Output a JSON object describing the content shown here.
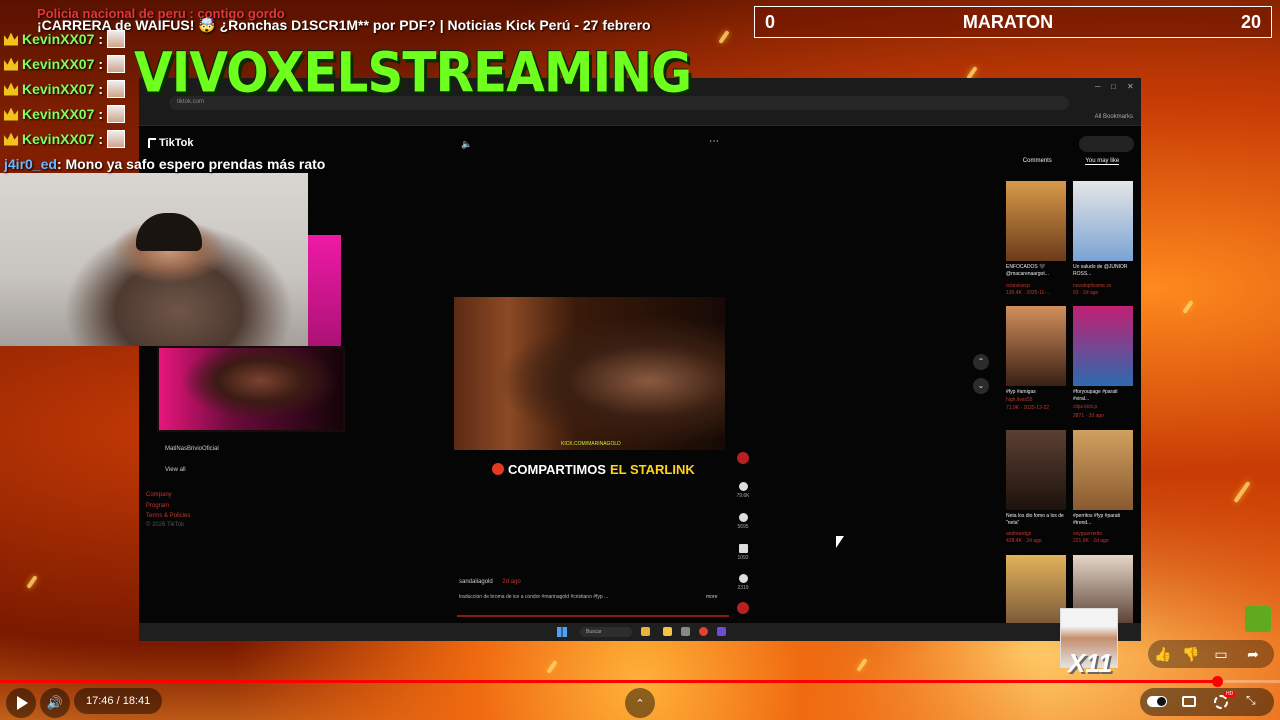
{
  "overlay": {
    "news_top": "Policia nacional de peru : contigo gordo",
    "news_ticker": "¡CARRERA de WAIFUS! 🤯 ¿Ronchas D1SCR1M** por PDF? | Noticias Kick Perú - 27 febrero",
    "scoreboard": {
      "left": "0",
      "title": "MARATON",
      "right": "20"
    },
    "channel_name": "VIVOXELSTREAMING",
    "chat": [
      {
        "user": "KevinXX07",
        "sep": " :"
      },
      {
        "user": "KevinXX07",
        "sep": " :"
      },
      {
        "user": "KevinXX07",
        "sep": " :"
      },
      {
        "user": "KevinXX07",
        "sep": " :"
      },
      {
        "user": "KevinXX07",
        "sep": " :"
      }
    ],
    "chat_msg": {
      "user": "j4ir0_ed",
      "text": " : Mono ya safo espero prendas más rato"
    },
    "multiplier": "X11"
  },
  "browser": {
    "url": "tiktok.com",
    "bookmarks": "All Bookmarks"
  },
  "tiktok": {
    "logo": "TikTok",
    "sidebar": [
      "MatiNasBrivioOficial",
      "View all"
    ],
    "footer": [
      "Company",
      "Program",
      "Terms & Policies",
      "© 2026 TikTok"
    ],
    "caption_pre": "COMPARTIMOS",
    "caption_hl": "EL STARLINK",
    "video_watermark": "KICK.COM/MARINAGOLD",
    "actions": [
      "79.6K",
      "5695",
      "1092",
      "2319"
    ],
    "post_user": "sandaliagold",
    "post_age": "2d ago",
    "post_desc": "traduccion de broma de ice a condor #marinagold #cristiano #fyp ...",
    "post_more": "more",
    "right_tabs": [
      "Comments",
      "You may like"
    ],
    "thumbs": [
      {
        "title": "ENFOCADOS 🖤 @macarenaargot...",
        "user": "octavioecp",
        "meta": "130.4K · 2025-11-..."
      },
      {
        "title": "Un saludo de @JUNIOR ROSS...",
        "user": "novaloplicame.zs",
        "meta": "93 · 2d ago"
      },
      {
        "title": "#fyp #amigas",
        "user": "high.lives55",
        "meta": "71.9K · 2025-12-22"
      },
      {
        "title": "#foryoupage #parati #viral...",
        "user": "clips.kick.p",
        "meta": "2871 · 2d ago"
      },
      {
        "title": "Neta los dio fomo a los de \"neta\"",
        "user": "andreardgz",
        "meta": "428.4K · 2d ago"
      },
      {
        "title": "#perritos #fyp #parati #trend...",
        "user": "soyguerrerito",
        "meta": "221.9K · 2d ago"
      }
    ],
    "taskbar_search": "Buscar"
  },
  "player": {
    "time": "17:46 / 18:41",
    "progress": 0.9507,
    "hd": "HD"
  },
  "colors": {
    "accent_green": "#6fff1f",
    "yt_red": "#ff0000",
    "starlink_yellow": "#ffd21c"
  }
}
